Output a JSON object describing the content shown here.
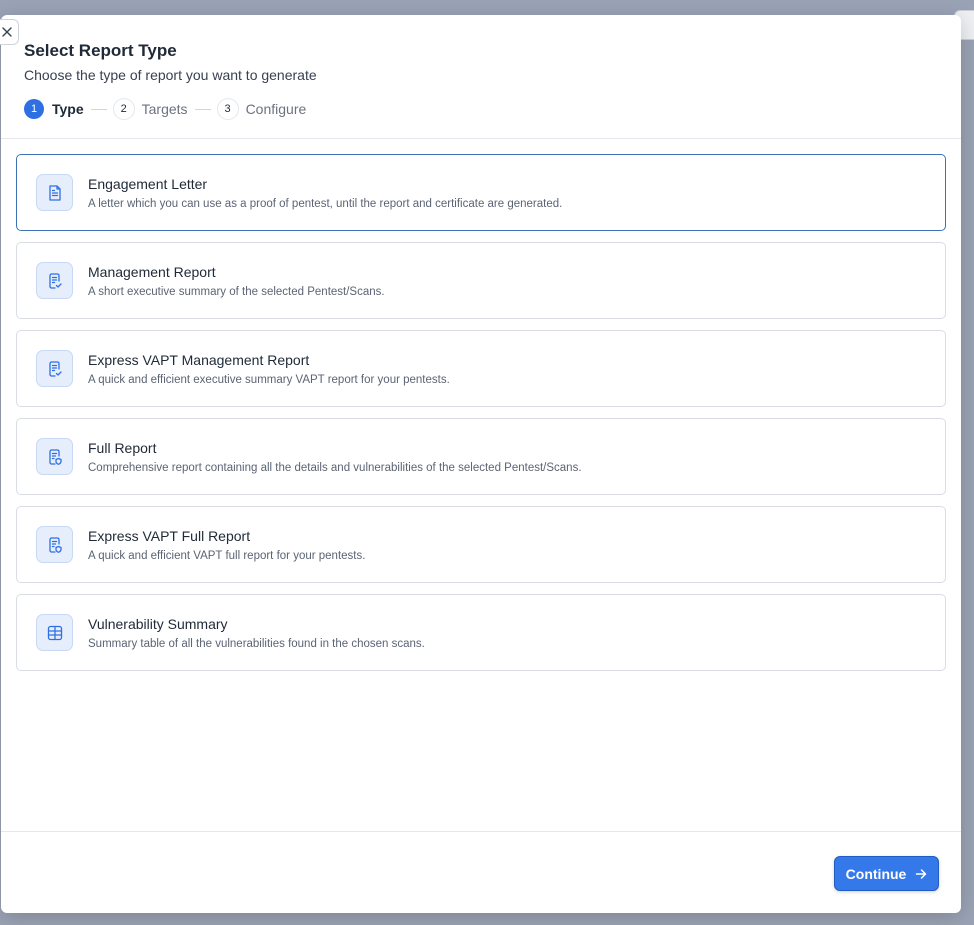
{
  "modal": {
    "title": "Select Report Type",
    "subtitle": "Choose the type of report you want to generate",
    "steps": [
      {
        "num": "1",
        "label": "Type"
      },
      {
        "num": "2",
        "label": "Targets"
      },
      {
        "num": "3",
        "label": "Configure"
      }
    ],
    "active_step": "1",
    "report_types": [
      {
        "title": "Engagement Letter",
        "desc": "A letter which you can use as a proof of pentest, until the report and certificate are generated.",
        "icon": "document-icon",
        "selected": true
      },
      {
        "title": "Management Report",
        "desc": "A short executive summary of the selected Pentest/Scans.",
        "icon": "document-check-icon",
        "selected": false
      },
      {
        "title": "Express VAPT Management Report",
        "desc": "A quick and efficient executive summary VAPT report for your pentests.",
        "icon": "document-check-icon",
        "selected": false
      },
      {
        "title": "Full Report",
        "desc": "Comprehensive report containing all the details and vulnerabilities of the selected Pentest/Scans.",
        "icon": "document-shield-icon",
        "selected": false
      },
      {
        "title": "Express VAPT Full Report",
        "desc": "A quick and efficient VAPT full report for your pentests.",
        "icon": "document-shield-icon",
        "selected": false
      },
      {
        "title": "Vulnerability Summary",
        "desc": "Summary table of all the vulnerabilities found in the chosen scans.",
        "icon": "table-icon",
        "selected": false
      }
    ],
    "continue_label": "Continue"
  },
  "colors": {
    "accent": "#3578ea",
    "selected_border": "#3e72b8",
    "icon_bg": "#e6eefb"
  }
}
